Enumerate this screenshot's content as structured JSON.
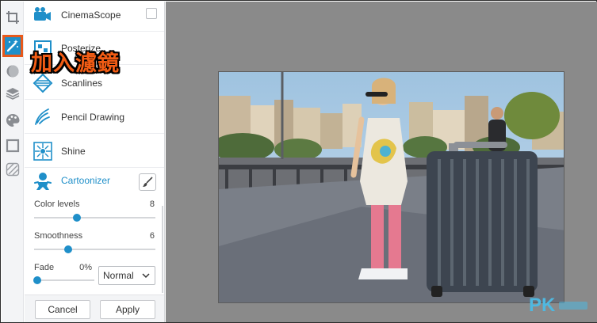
{
  "colors": {
    "accent": "#1f8fc9",
    "highlight": "#e8591b",
    "workspace": "#8a8a8a"
  },
  "toolbar": {
    "tools": [
      {
        "icon": "crop-icon"
      },
      {
        "icon": "magic-wand-icon",
        "active": true
      },
      {
        "icon": "sticker-icon"
      },
      {
        "icon": "layers-icon"
      },
      {
        "icon": "palette-icon"
      },
      {
        "icon": "frame-icon"
      },
      {
        "icon": "texture-icon"
      }
    ]
  },
  "overlay": {
    "caption": "加入濾鏡"
  },
  "filters": [
    {
      "label": "CinemaScope",
      "icon": "film-camera-icon"
    },
    {
      "label": "Posterize",
      "icon": "posterize-icon"
    },
    {
      "label": "Scanlines",
      "icon": "scanlines-icon"
    },
    {
      "label": "Pencil Drawing",
      "icon": "pencil-drawing-icon"
    },
    {
      "label": "Shine",
      "icon": "shine-icon"
    }
  ],
  "active_filter": {
    "label": "Cartoonizer",
    "icon": "cartoonizer-icon",
    "sliders": [
      {
        "label": "Color levels",
        "value": "8",
        "fraction": 0.35
      },
      {
        "label": "Smoothness",
        "value": "6",
        "fraction": 0.28
      }
    ],
    "fade": {
      "label": "Fade",
      "value": "0%",
      "fraction": 0.0
    },
    "blend_mode": "Normal"
  },
  "footer": {
    "cancel_label": "Cancel",
    "apply_label": "Apply"
  },
  "watermark": "PK"
}
